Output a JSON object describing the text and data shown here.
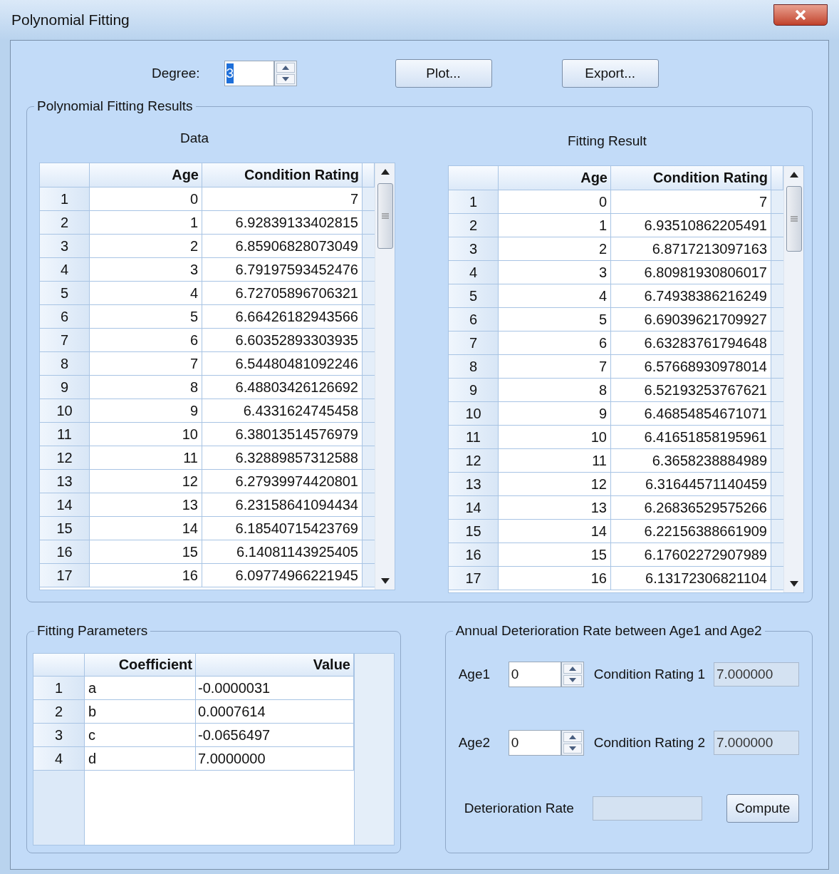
{
  "window": {
    "title": "Polynomial Fitting"
  },
  "degree": {
    "label": "Degree:",
    "value": "3",
    "value_selected": true
  },
  "buttons": [
    {
      "label": "Plot..."
    },
    {
      "label": "Export..."
    }
  ],
  "results": {
    "title": "Polynomial Fitting Results",
    "tables": [
      {
        "caption": "Data",
        "columns": [
          "",
          "Age",
          "Condition Rating"
        ],
        "rows": [
          [
            "1",
            "0",
            "7"
          ],
          [
            "2",
            "1",
            "6.92839133402815"
          ],
          [
            "3",
            "2",
            "6.85906828073049"
          ],
          [
            "4",
            "3",
            "6.79197593452476"
          ],
          [
            "5",
            "4",
            "6.72705896706321"
          ],
          [
            "6",
            "5",
            "6.66426182943566"
          ],
          [
            "7",
            "6",
            "6.60352893303935"
          ],
          [
            "8",
            "7",
            "6.54480481092246"
          ],
          [
            "9",
            "8",
            "6.48803426126692"
          ],
          [
            "10",
            "9",
            "6.4331624745458"
          ],
          [
            "11",
            "10",
            "6.38013514576979"
          ],
          [
            "12",
            "11",
            "6.32889857312588"
          ],
          [
            "13",
            "12",
            "6.27939974420801"
          ],
          [
            "14",
            "13",
            "6.23158641094434"
          ],
          [
            "15",
            "14",
            "6.18540715423769"
          ],
          [
            "16",
            "15",
            "6.14081143925405"
          ],
          [
            "17",
            "16",
            "6.09774966221945"
          ]
        ]
      },
      {
        "caption": "Fitting Result",
        "columns": [
          "",
          "Age",
          "Condition Rating"
        ],
        "rows": [
          [
            "1",
            "0",
            "7"
          ],
          [
            "2",
            "1",
            "6.93510862205491"
          ],
          [
            "3",
            "2",
            "6.8717213097163"
          ],
          [
            "4",
            "3",
            "6.80981930806017"
          ],
          [
            "5",
            "4",
            "6.74938386216249"
          ],
          [
            "6",
            "5",
            "6.69039621709927"
          ],
          [
            "7",
            "6",
            "6.63283761794648"
          ],
          [
            "8",
            "7",
            "6.57668930978014"
          ],
          [
            "9",
            "8",
            "6.52193253767621"
          ],
          [
            "10",
            "9",
            "6.46854854671071"
          ],
          [
            "11",
            "10",
            "6.41651858195961"
          ],
          [
            "12",
            "11",
            "6.3658238884989"
          ],
          [
            "13",
            "12",
            "6.31644571140459"
          ],
          [
            "14",
            "13",
            "6.26836529575266"
          ],
          [
            "15",
            "14",
            "6.22156388661909"
          ],
          [
            "16",
            "15",
            "6.17602272907989"
          ],
          [
            "17",
            "16",
            "6.13172306821104"
          ]
        ]
      }
    ]
  },
  "parameters": {
    "title": "Fitting Parameters",
    "columns": [
      "",
      "Coefficient",
      "Value"
    ],
    "rows": [
      [
        "1",
        "a",
        "-0.0000031"
      ],
      [
        "2",
        "b",
        "0.0007614"
      ],
      [
        "3",
        "c",
        "-0.0656497"
      ],
      [
        "4",
        "d",
        "7.0000000"
      ]
    ]
  },
  "deterioration": {
    "title": "Annual Deterioration Rate between Age1 and Age2",
    "ages": [
      {
        "label": "Age1",
        "value": "0",
        "result_label": "Condition Rating 1",
        "result": "7.000000"
      },
      {
        "label": "Age2",
        "value": "0",
        "result_label": "Condition Rating 2",
        "result": "7.000000"
      }
    ],
    "rate_label": "Deterioration Rate",
    "compute": "Compute"
  }
}
